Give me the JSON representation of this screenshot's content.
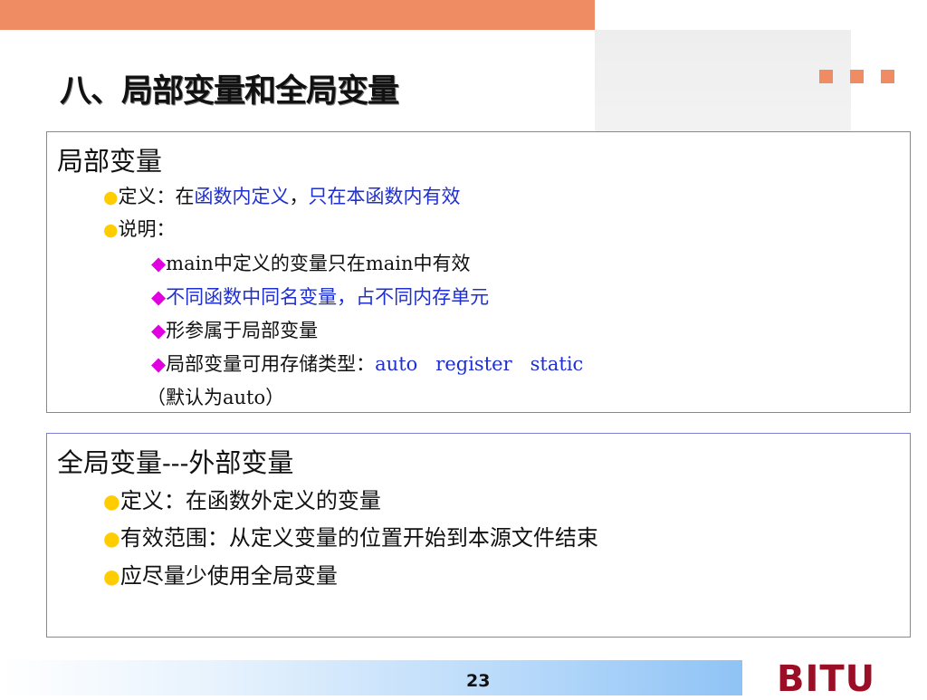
{
  "title": "八、局部变量和全局变量",
  "section1": {
    "heading": "局部变量",
    "definition_prefix": "定义：在",
    "definition_blue1": "函数内定义",
    "definition_sep": "，",
    "definition_blue2": "只在本函数内有效",
    "explanation_label": "说明：",
    "items": [
      "main中定义的变量只在main中有效",
      "不同函数中同名变量，占不同内存单元",
      "形参属于局部变量"
    ],
    "storage_prefix": "局部变量可用存储类型：",
    "storage_types": "auto   register   static",
    "storage_default": "（默认为auto）"
  },
  "section2": {
    "heading": "全局变量---外部变量",
    "items": [
      "定义：在函数外定义的变量",
      "有效范围：从定义变量的位置开始到本源文件结束",
      "应尽量少使用全局变量"
    ]
  },
  "footer": {
    "page_number": "23",
    "logo": "BITU"
  },
  "colors": {
    "accent_orange": "#f08c64",
    "text_blue": "#1f2fd0",
    "text_magenta": "#e000e0",
    "bullet_yellow": "#ffcc00",
    "logo_red": "#9a0f25"
  },
  "icons": {
    "bullet": "●",
    "diamond": "◆"
  }
}
